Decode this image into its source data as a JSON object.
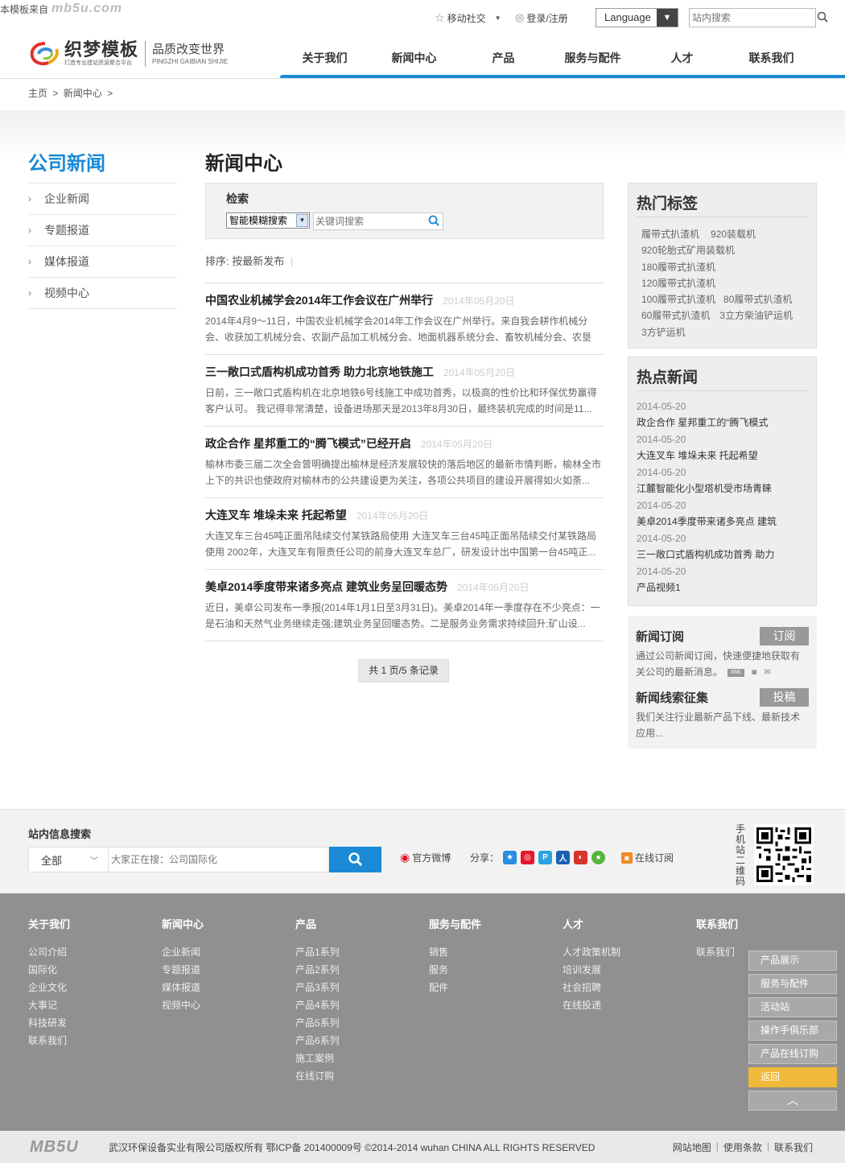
{
  "watermark": {
    "text": "本模板来自",
    "logo": "mb5u.com"
  },
  "topbar": {
    "mobile": "移动社交",
    "login": "登录/注册",
    "language": "Language",
    "search_placeholder": "站内搜索"
  },
  "logo": {
    "name": "织梦模板",
    "sub": "打造专业建站资源聚合平台",
    "slogan": "品质改变世界",
    "slogan_pinyin": "PINGZHI GAIBIAN SHIJIE"
  },
  "nav": [
    "关于我们",
    "新闻中心",
    "产品",
    "服务与配件",
    "人才",
    "联系我们"
  ],
  "breadcrumb": [
    "主页",
    ">",
    "新闻中心",
    ">"
  ],
  "sidebar": {
    "title": "公司新闻",
    "items": [
      "企业新闻",
      "专题报道",
      "媒体报道",
      "视频中心"
    ]
  },
  "main": {
    "title": "新闻中心",
    "search": {
      "label": "检索",
      "select_value": "智能模糊搜索",
      "input_placeholder": "关键词搜索"
    },
    "sort": {
      "label": "排序:",
      "value": "按最新发布"
    },
    "news": [
      {
        "title": "中国农业机械学会2014年工作会议在广州举行",
        "date": "2014年05月20日",
        "desc": "2014年4月9～11日，中国农业机械学会2014年工作会议在广州举行。来自我会耕作机械分会、收获加工机械分会、农副产品加工机械分会、地面机器系统分会、畜牧机械分会、农垦"
      },
      {
        "title": "三一敞口式盾构机成功首秀 助力北京地铁施工",
        "date": "2014年05月20日",
        "desc": "日前，三一敞口式盾构机在北京地铁6号线施工中成功首秀，以极高的性价比和环保优势赢得客户认可。 我记得非常清楚，设备进场那天是2013年8月30日，最终装机完成的时间是11..."
      },
      {
        "title": "政企合作 星邦重工的“腾飞模式”已经开启",
        "date": "2014年05月20日",
        "desc": "榆林市委三届二次全会曾明确提出榆林是经济发展较快的落后地区的最新市情判断，榆林全市上下的共识也使政府对榆林市的公共建设更为关注，各项公共项目的建设开展得如火如荼..."
      },
      {
        "title": "大连叉车 堆垛未来 托起希望",
        "date": "2014年05月20日",
        "desc": "大连叉车三台45吨正面吊陆续交付某铁路局使用 大连叉车三台45吨正面吊陆续交付某铁路局使用 2002年，大连叉车有限责任公司的前身大连叉车总厂，研发设计出中国第一台45吨正..."
      },
      {
        "title": "美卓2014季度带来诸多亮点 建筑业务呈回暖态势",
        "date": "2014年05月20日",
        "desc": "近日，美卓公司发布一季报(2014年1月1日至3月31日)。美卓2014年一季度存在不少亮点：一是石油和天然气业务继续走强;建筑业务呈回暖态势。二是服务业务需求持续回升;矿山设..."
      }
    ],
    "pager": "共 1 页/5 条记录"
  },
  "right": {
    "tags_title": "热门标签",
    "tags": [
      "履带式扒渣机",
      "920装载机",
      "920轮胎式矿用装载机",
      "180履带式扒渣机",
      "120履带式扒渣机",
      "100履带式扒渣机",
      "80履带式扒渣机",
      "60履带式扒渣机",
      "3立方柴油铲运机",
      "3方铲运机"
    ],
    "hot_title": "热点新闻",
    "hot": [
      {
        "date": "2014-05-20",
        "title": "政企合作 星邦重工的“腾飞模式"
      },
      {
        "date": "2014-05-20",
        "title": "大连叉车 堆垛未来 托起希望"
      },
      {
        "date": "2014-05-20",
        "title": "江麓智能化小型塔机受市场青睐"
      },
      {
        "date": "2014-05-20",
        "title": "美卓2014季度带来诸多亮点 建筑"
      },
      {
        "date": "2014-05-20",
        "title": "三一敞口式盾构机成功首秀 助力"
      },
      {
        "date": "2014-05-20",
        "title": "产品视频1"
      }
    ],
    "subscribe": {
      "title": "新闻订阅",
      "button": "订阅",
      "desc": "通过公司新闻订阅，快速便捷地获取有关公司的最新消息。",
      "xml": "XML"
    },
    "contribute": {
      "title": "新闻线索征集",
      "button": "投稿",
      "desc": "我们关注行业最新产品下线、最新技术应用..."
    }
  },
  "footer_search": {
    "title": "站内信息搜索",
    "category": "全部",
    "placeholder": "大家正在搜：公司国际化",
    "weibo": "官方微博",
    "share": "分享：",
    "rss": "在线订阅",
    "qr_label": "手机站二维码"
  },
  "footer_cols": [
    {
      "title": "关于我们",
      "items": [
        "公司介绍",
        "国际化",
        "企业文化",
        "大事记",
        "科技研发",
        "联系我们"
      ]
    },
    {
      "title": "新闻中心",
      "items": [
        "企业新闻",
        "专题报道",
        "媒体报道",
        "视频中心"
      ]
    },
    {
      "title": "产品",
      "items": [
        "产品1系列",
        "产品2系列",
        "产品3系列",
        "产品4系列",
        "产品5系列",
        "产品6系列",
        "施工案例",
        "在线订购"
      ]
    },
    {
      "title": "服务与配件",
      "items": [
        "销售",
        "服务",
        "配件"
      ]
    },
    {
      "title": "人才",
      "items": [
        "人才政策机制",
        "培训发展",
        "社会招聘",
        "在线投递"
      ]
    },
    {
      "title": "联系我们",
      "items": [
        "联系我们"
      ]
    }
  ],
  "float_menu": [
    "产品展示",
    "服务与配件",
    "活动站",
    "操作手俱乐部",
    "产品在线订购",
    "返回"
  ],
  "copyright": {
    "logo": "MB5U",
    "text": "武汉环保设备实业有限公司版权所有  鄂ICP备 201400009号  ©2014-2014 wuhan CHINA ALL RIGHTS RESERVED",
    "links": [
      "网站地图",
      "使用条款",
      "联系我们"
    ]
  }
}
